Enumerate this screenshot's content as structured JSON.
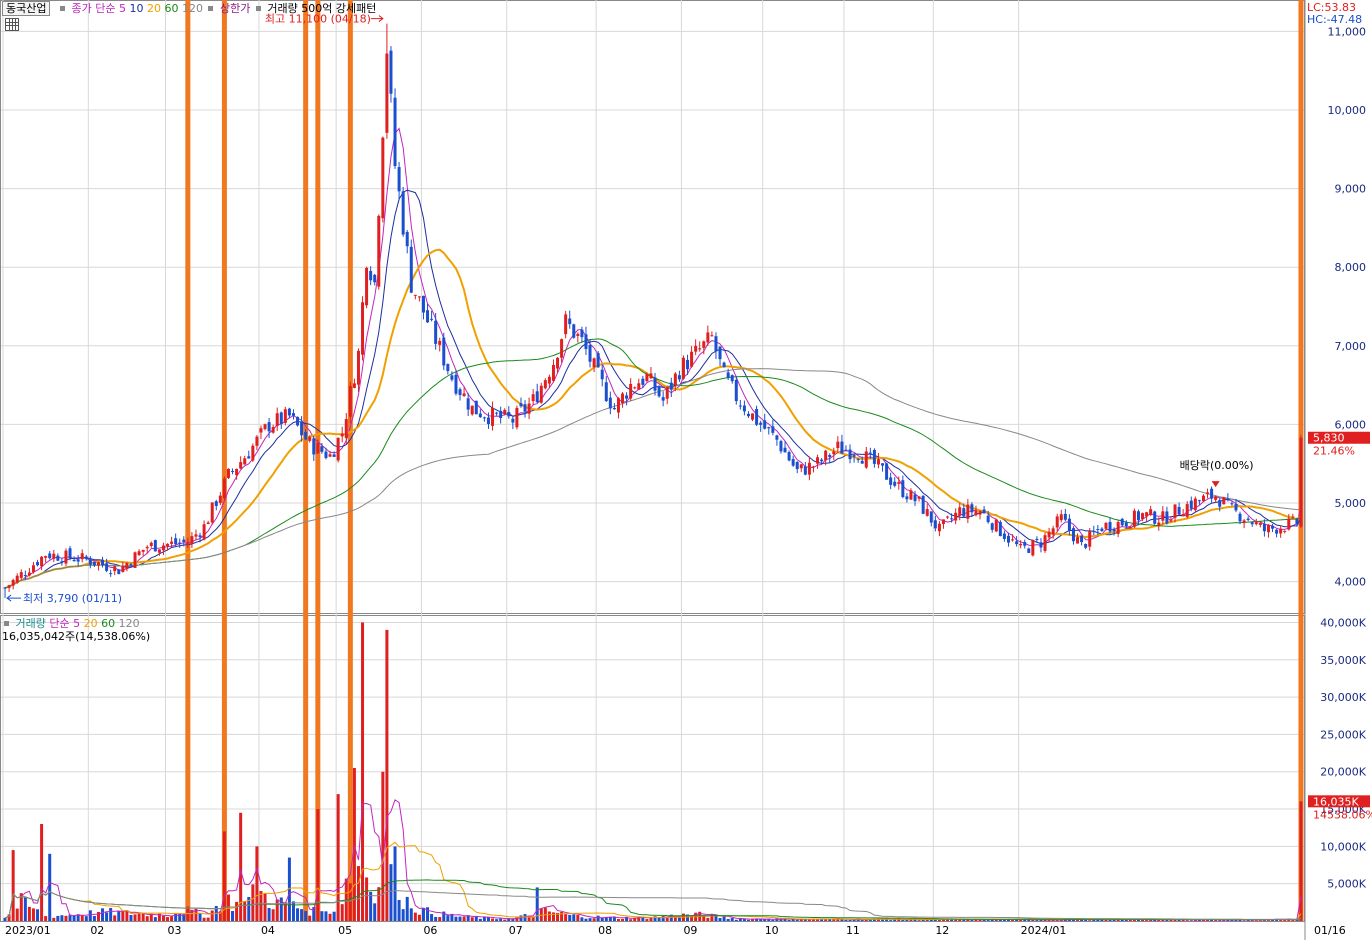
{
  "header": {
    "stock_name": "동국산업",
    "ma_label": "종가 단순",
    "ma_periods": [
      "5",
      "10",
      "20",
      "60",
      "120"
    ],
    "ma_colors": [
      "#c026c0",
      "#1c2ea0",
      "#f0a000",
      "#1a8a1a",
      "#888888"
    ],
    "limit_up_label": "상한가",
    "volume_label": "거래량 500억",
    "pattern_label": "강세패턴",
    "lc_label": "LC:53.83",
    "hc_label": "HC:-47.48"
  },
  "volume_header": {
    "label": "거래량",
    "ma_label": "단순",
    "ma_periods": [
      "5",
      "20",
      "60",
      "120"
    ],
    "value_text": "16,035,042주(14,538.06%)"
  },
  "annotations": {
    "high": "최고 11,100 (04/18)",
    "low": "최저 3,790 (01/11)",
    "dividend": "배당락(0.00%)",
    "last_price": "5,830",
    "last_change": "21.46%",
    "last_volume": "16,035K",
    "last_volume_pct": "14538.06%"
  },
  "colors": {
    "up": "#e02020",
    "down": "#1a4fd0",
    "highlight": "#f07820",
    "grid": "#d8d8d8",
    "axis_text": "#1a2a80"
  },
  "chart_data": {
    "type": "candlestick",
    "price_axis": {
      "ylim": [
        3600,
        11400
      ],
      "ticks": [
        "4,000",
        "5,000",
        "6,000",
        "7,000",
        "8,000",
        "9,000",
        "10,000",
        "11,000"
      ]
    },
    "volume_axis": {
      "ylim": [
        0,
        41000
      ],
      "ticks": [
        "5,000K",
        "10,000K",
        "15,000K",
        "20,000K",
        "25,000K",
        "30,000K",
        "35,000K",
        "40,000K"
      ]
    },
    "x_labels": [
      "2023/01",
      "02",
      "03",
      "04",
      "05",
      "06",
      "07",
      "08",
      "09",
      "10",
      "11",
      "12",
      "2024/01",
      "01/16"
    ],
    "anchors": [
      [
        0,
        3920
      ],
      [
        10,
        4350
      ],
      [
        20,
        4280
      ],
      [
        28,
        4150
      ],
      [
        35,
        4450
      ],
      [
        45,
        4500
      ],
      [
        49,
        4700
      ],
      [
        55,
        5350
      ],
      [
        60,
        5650
      ],
      [
        65,
        6000
      ],
      [
        70,
        6100
      ],
      [
        75,
        5750
      ],
      [
        80,
        5600
      ],
      [
        83,
        5900
      ],
      [
        87,
        6900
      ],
      [
        89,
        8150
      ],
      [
        91,
        7800
      ],
      [
        94,
        10800
      ],
      [
        96,
        9300
      ],
      [
        100,
        7800
      ],
      [
        105,
        7200
      ],
      [
        110,
        6600
      ],
      [
        115,
        6200
      ],
      [
        120,
        6100
      ],
      [
        125,
        6050
      ],
      [
        130,
        6300
      ],
      [
        135,
        6800
      ],
      [
        138,
        7300
      ],
      [
        142,
        7050
      ],
      [
        146,
        6600
      ],
      [
        150,
        6200
      ],
      [
        154,
        6500
      ],
      [
        158,
        6600
      ],
      [
        162,
        6300
      ],
      [
        166,
        6700
      ],
      [
        170,
        6900
      ],
      [
        174,
        7100
      ],
      [
        177,
        6600
      ],
      [
        180,
        6350
      ],
      [
        185,
        6050
      ],
      [
        190,
        5800
      ],
      [
        195,
        5400
      ],
      [
        200,
        5500
      ],
      [
        205,
        5700
      ],
      [
        210,
        5650
      ],
      [
        215,
        5450
      ],
      [
        220,
        5200
      ],
      [
        225,
        5000
      ],
      [
        230,
        4650
      ],
      [
        235,
        4900
      ],
      [
        240,
        4900
      ],
      [
        245,
        4650
      ],
      [
        250,
        4400
      ],
      [
        255,
        4500
      ],
      [
        260,
        4800
      ],
      [
        265,
        4450
      ],
      [
        270,
        4700
      ],
      [
        275,
        4750
      ],
      [
        280,
        4850
      ],
      [
        285,
        4800
      ],
      [
        290,
        4950
      ],
      [
        295,
        5050
      ],
      [
        298,
        5100
      ],
      [
        302,
        4900
      ],
      [
        306,
        4800
      ],
      [
        310,
        4650
      ],
      [
        314,
        4700
      ],
      [
        318,
        4750
      ]
    ],
    "volume_anchors": [
      [
        0,
        500
      ],
      [
        4,
        2500
      ],
      [
        10,
        600
      ],
      [
        25,
        1200
      ],
      [
        40,
        800
      ],
      [
        44,
        1500
      ],
      [
        50,
        700
      ],
      [
        54,
        3000
      ],
      [
        58,
        1800
      ],
      [
        62,
        4000
      ],
      [
        66,
        2500
      ],
      [
        70,
        2200
      ],
      [
        74,
        1500
      ],
      [
        78,
        1000
      ],
      [
        82,
        2000
      ],
      [
        86,
        8000
      ],
      [
        89,
        6000
      ],
      [
        92,
        4000
      ],
      [
        95,
        9000
      ],
      [
        98,
        3000
      ],
      [
        102,
        1500
      ],
      [
        106,
        1000
      ],
      [
        112,
        600
      ],
      [
        118,
        400
      ],
      [
        125,
        300
      ],
      [
        133,
        1300
      ],
      [
        140,
        700
      ],
      [
        150,
        400
      ],
      [
        160,
        500
      ],
      [
        170,
        900
      ],
      [
        180,
        300
      ],
      [
        200,
        250
      ],
      [
        240,
        200
      ],
      [
        280,
        220
      ],
      [
        310,
        180
      ],
      [
        318,
        250
      ]
    ],
    "volume_spikes": [
      [
        2,
        9500
      ],
      [
        9,
        13000
      ],
      [
        11,
        9000
      ],
      [
        54,
        12000
      ],
      [
        58,
        14500
      ],
      [
        62,
        10000
      ],
      [
        70,
        8500
      ],
      [
        77,
        15000
      ],
      [
        82,
        17000
      ],
      [
        86,
        20500
      ],
      [
        88,
        40000
      ],
      [
        93,
        20000
      ],
      [
        94,
        39000
      ],
      [
        131,
        4500
      ],
      [
        319,
        16035
      ]
    ],
    "highlight_bars": [
      45,
      54,
      74,
      77,
      85,
      319
    ],
    "n_bars": 320,
    "ma_windows": [
      5,
      10,
      20,
      60,
      120
    ]
  }
}
